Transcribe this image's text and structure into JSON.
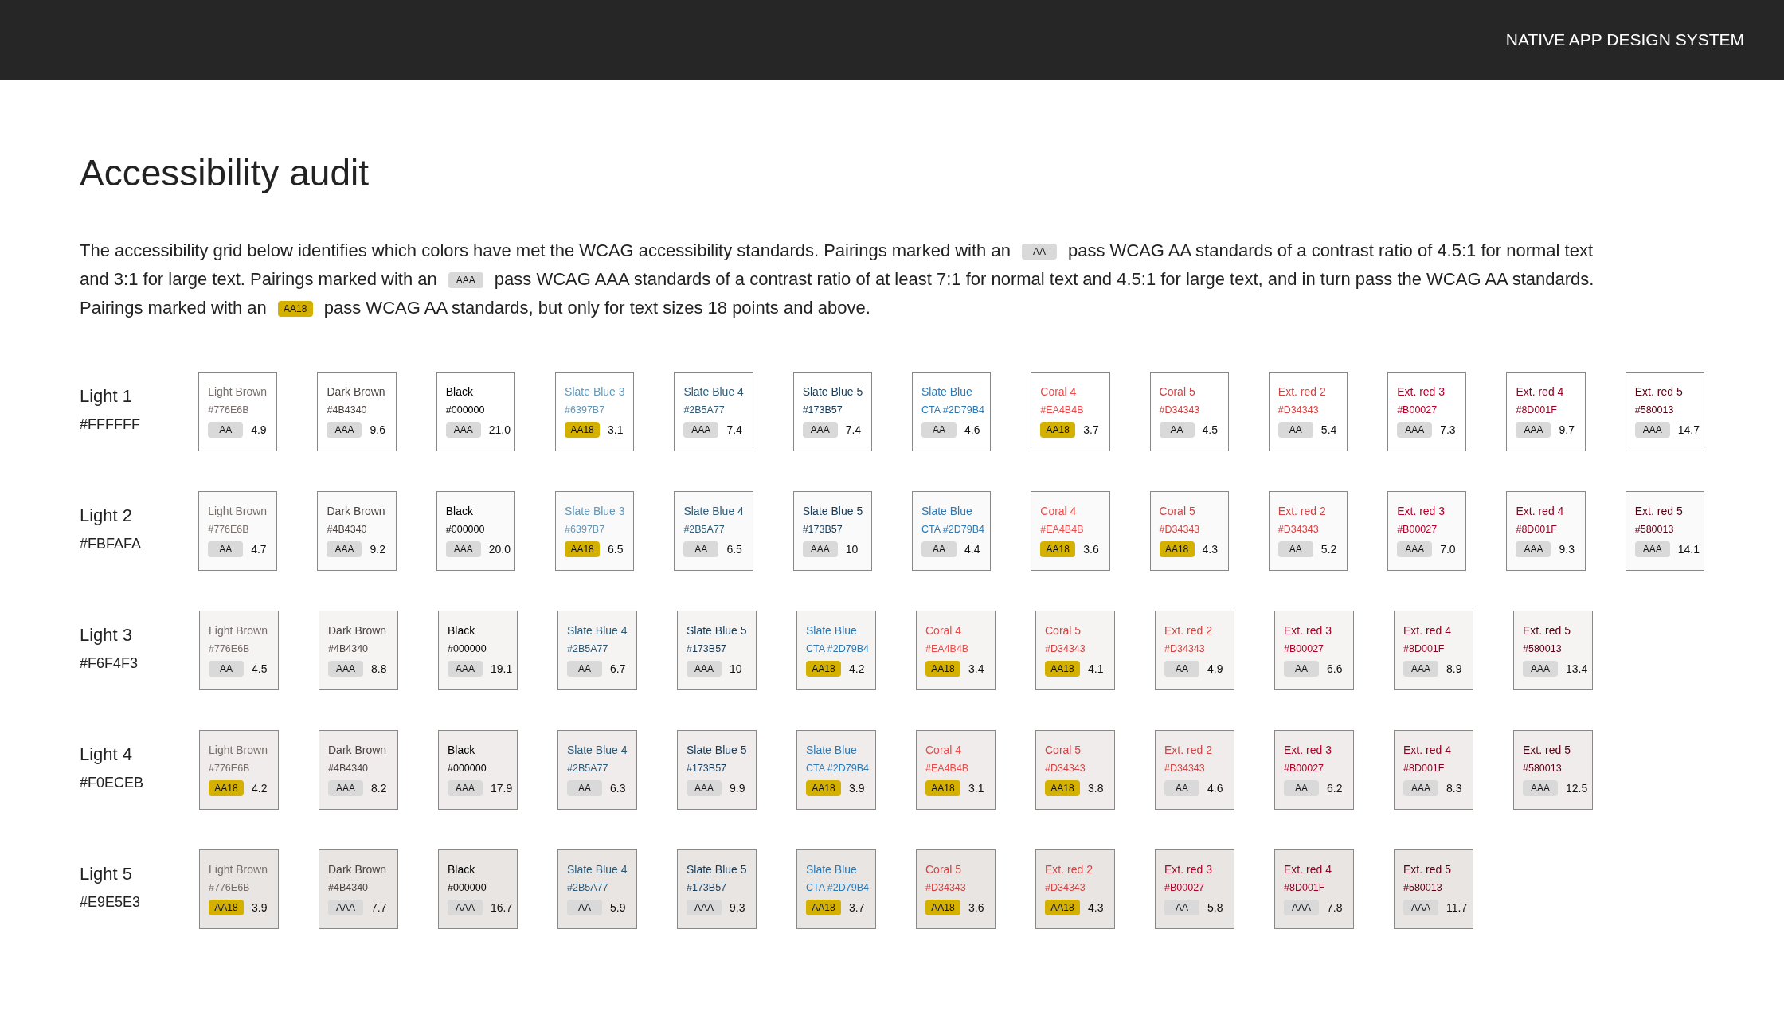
{
  "header": {
    "title": "NATIVE APP DESIGN SYSTEM"
  },
  "page_title": "Accessibility audit",
  "intro": [
    {
      "kind": "text",
      "text": "The accessibility grid below identifies which colors have met the WCAG accessibility standards. Pairings marked with an"
    },
    {
      "kind": "aa",
      "text": "AA"
    },
    {
      "kind": "text",
      "text": "pass WCAG AA standards of a contrast ratio of 4.5:1 for normal text"
    },
    {
      "kind": "break"
    },
    {
      "kind": "text",
      "text": "and 3:1 for large text. Pairings marked with an"
    },
    {
      "kind": "aaa",
      "text": "AAA"
    },
    {
      "kind": "text",
      "text": "pass  WCAG AAA standards of a contrast ratio of at least 7:1 for normal text and 4.5:1 for large text, and in turn pass the WCAG AA standards."
    },
    {
      "kind": "break"
    },
    {
      "kind": "text",
      "text": "Pairings marked with an"
    },
    {
      "kind": "aa18",
      "text": "AA18"
    },
    {
      "kind": "text",
      "text": "pass WCAG AA standards, but only for text sizes 18 points and above."
    }
  ],
  "rows": [
    {
      "name": "Light 1",
      "hex": "#FFFFFF",
      "color": "#ffffff",
      "swatches": [
        {
          "name": "Light Brown",
          "hex": "#776E6B",
          "color": "#776e6b",
          "kind": "aa",
          "grade": "AA",
          "ratio": "4.9"
        },
        {
          "name": "Dark Brown",
          "hex": "#4B4340",
          "color": "#4b4340",
          "kind": "aaa",
          "grade": "AAA",
          "ratio": "9.6"
        },
        {
          "name": "Black",
          "hex": "#000000",
          "color": "#000000",
          "kind": "aaa",
          "grade": "AAA",
          "ratio": "21.0"
        },
        {
          "name": "Slate Blue 3",
          "hex": "#6397B7",
          "color": "#6397b7",
          "kind": "aa18",
          "grade": "AA18",
          "ratio": "3.1"
        },
        {
          "name": "Slate Blue 4",
          "hex": "#2B5A77",
          "color": "#2b5a77",
          "kind": "aaa",
          "grade": "AAA",
          "ratio": "7.4"
        },
        {
          "name": "Slate Blue 5",
          "hex": "#173B57",
          "color": "#173b57",
          "kind": "aaa",
          "grade": "AAA",
          "ratio": "7.4"
        },
        {
          "name": "Slate Blue",
          "hex": "CTA #2D79B4",
          "color": "#2d79b4",
          "kind": "aa",
          "grade": "AA",
          "ratio": "4.6"
        },
        {
          "name": "Coral 4",
          "hex": "#EA4B4B",
          "color": "#ea4b4b",
          "kind": "aa18",
          "grade": "AA18",
          "ratio": "3.7"
        },
        {
          "name": "Coral 5",
          "hex": "#D34343",
          "color": "#d34343",
          "kind": "aa",
          "grade": "AA",
          "ratio": "4.5"
        },
        {
          "name": "Ext. red 2",
          "hex": "#D34343",
          "color": "#d34343",
          "kind": "aa",
          "grade": "AA",
          "ratio": "5.4"
        },
        {
          "name": "Ext. red 3",
          "hex": "#B00027",
          "color": "#b00027",
          "kind": "aaa",
          "grade": "AAA",
          "ratio": "7.3"
        },
        {
          "name": "Ext. red 4",
          "hex": "#8D001F",
          "color": "#8d001f",
          "kind": "aaa",
          "grade": "AAA",
          "ratio": "9.7"
        },
        {
          "name": "Ext. red 5",
          "hex": "#580013",
          "color": "#580013",
          "kind": "aaa",
          "grade": "AAA",
          "ratio": "14.7"
        }
      ]
    },
    {
      "name": "Light 2",
      "hex": "#FBFAFA",
      "color": "#fbfafa",
      "swatches": [
        {
          "name": "Light Brown",
          "hex": "#776E6B",
          "color": "#776e6b",
          "kind": "aa",
          "grade": "AA",
          "ratio": "4.7"
        },
        {
          "name": "Dark Brown",
          "hex": "#4B4340",
          "color": "#4b4340",
          "kind": "aaa",
          "grade": "AAA",
          "ratio": "9.2"
        },
        {
          "name": "Black",
          "hex": "#000000",
          "color": "#000000",
          "kind": "aaa",
          "grade": "AAA",
          "ratio": "20.0"
        },
        {
          "name": "Slate Blue 3",
          "hex": "#6397B7",
          "color": "#6397b7",
          "kind": "aa18",
          "grade": "AA18",
          "ratio": "6.5"
        },
        {
          "name": "Slate Blue 4",
          "hex": "#2B5A77",
          "color": "#2b5a77",
          "kind": "aa",
          "grade": "AA",
          "ratio": "6.5"
        },
        {
          "name": "Slate Blue 5",
          "hex": "#173B57",
          "color": "#173b57",
          "kind": "aaa",
          "grade": "AAA",
          "ratio": "10"
        },
        {
          "name": "Slate Blue",
          "hex": "CTA #2D79B4",
          "color": "#2d79b4",
          "kind": "aa",
          "grade": "AA",
          "ratio": "4.4"
        },
        {
          "name": "Coral 4",
          "hex": "#EA4B4B",
          "color": "#ea4b4b",
          "kind": "aa18",
          "grade": "AA18",
          "ratio": "3.6"
        },
        {
          "name": "Coral 5",
          "hex": "#D34343",
          "color": "#d34343",
          "kind": "aa18",
          "grade": "AA18",
          "ratio": "4.3"
        },
        {
          "name": "Ext. red 2",
          "hex": "#D34343",
          "color": "#d34343",
          "kind": "aa",
          "grade": "AA",
          "ratio": "5.2"
        },
        {
          "name": "Ext. red 3",
          "hex": "#B00027",
          "color": "#b00027",
          "kind": "aaa",
          "grade": "AAA",
          "ratio": "7.0"
        },
        {
          "name": "Ext. red 4",
          "hex": "#8D001F",
          "color": "#8d001f",
          "kind": "aaa",
          "grade": "AAA",
          "ratio": "9.3"
        },
        {
          "name": "Ext. red 5",
          "hex": "#580013",
          "color": "#580013",
          "kind": "aaa",
          "grade": "AAA",
          "ratio": "14.1"
        }
      ]
    },
    {
      "name": "Light 3",
      "hex": "#F6F4F3",
      "color": "#f6f4f3",
      "swatches": [
        {
          "name": "Light Brown",
          "hex": "#776E6B",
          "color": "#776e6b",
          "kind": "aa",
          "grade": "AA",
          "ratio": "4.5"
        },
        {
          "name": "Dark Brown",
          "hex": "#4B4340",
          "color": "#4b4340",
          "kind": "aaa",
          "grade": "AAA",
          "ratio": "8.8"
        },
        {
          "name": "Black",
          "hex": "#000000",
          "color": "#000000",
          "kind": "aaa",
          "grade": "AAA",
          "ratio": "19.1"
        },
        {
          "name": "Slate Blue 4",
          "hex": "#2B5A77",
          "color": "#2b5a77",
          "kind": "aa",
          "grade": "AA",
          "ratio": "6.7"
        },
        {
          "name": "Slate Blue 5",
          "hex": "#173B57",
          "color": "#173b57",
          "kind": "aaa",
          "grade": "AAA",
          "ratio": "10"
        },
        {
          "name": "Slate Blue",
          "hex": "CTA #2D79B4",
          "color": "#2d79b4",
          "kind": "aa18",
          "grade": "AA18",
          "ratio": "4.2"
        },
        {
          "name": "Coral 4",
          "hex": "#EA4B4B",
          "color": "#ea4b4b",
          "kind": "aa18",
          "grade": "AA18",
          "ratio": "3.4"
        },
        {
          "name": "Coral 5",
          "hex": "#D34343",
          "color": "#d34343",
          "kind": "aa18",
          "grade": "AA18",
          "ratio": "4.1"
        },
        {
          "name": "Ext. red 2",
          "hex": "#D34343",
          "color": "#d34343",
          "kind": "aa",
          "grade": "AA",
          "ratio": "4.9"
        },
        {
          "name": "Ext. red 3",
          "hex": "#B00027",
          "color": "#b00027",
          "kind": "aa",
          "grade": "AA",
          "ratio": "6.6"
        },
        {
          "name": "Ext. red 4",
          "hex": "#8D001F",
          "color": "#8d001f",
          "kind": "aaa",
          "grade": "AAA",
          "ratio": "8.9"
        },
        {
          "name": "Ext. red 5",
          "hex": "#580013",
          "color": "#580013",
          "kind": "aaa",
          "grade": "AAA",
          "ratio": "13.4"
        }
      ]
    },
    {
      "name": "Light 4",
      "hex": "#F0ECEB",
      "color": "#f0eceb",
      "swatches": [
        {
          "name": "Light Brown",
          "hex": "#776E6B",
          "color": "#776e6b",
          "kind": "aa18",
          "grade": "AA18",
          "ratio": "4.2"
        },
        {
          "name": "Dark Brown",
          "hex": "#4B4340",
          "color": "#4b4340",
          "kind": "aaa",
          "grade": "AAA",
          "ratio": "8.2"
        },
        {
          "name": "Black",
          "hex": "#000000",
          "color": "#000000",
          "kind": "aaa",
          "grade": "AAA",
          "ratio": "17.9"
        },
        {
          "name": "Slate Blue 4",
          "hex": "#2B5A77",
          "color": "#2b5a77",
          "kind": "aa",
          "grade": "AA",
          "ratio": "6.3"
        },
        {
          "name": "Slate Blue 5",
          "hex": "#173B57",
          "color": "#173b57",
          "kind": "aaa",
          "grade": "AAA",
          "ratio": "9.9"
        },
        {
          "name": "Slate Blue",
          "hex": "CTA #2D79B4",
          "color": "#2d79b4",
          "kind": "aa18",
          "grade": "AA18",
          "ratio": "3.9"
        },
        {
          "name": "Coral 4",
          "hex": "#EA4B4B",
          "color": "#ea4b4b",
          "kind": "aa18",
          "grade": "AA18",
          "ratio": "3.1"
        },
        {
          "name": "Coral 5",
          "hex": "#D34343",
          "color": "#d34343",
          "kind": "aa18",
          "grade": "AA18",
          "ratio": "3.8"
        },
        {
          "name": "Ext. red 2",
          "hex": "#D34343",
          "color": "#d34343",
          "kind": "aa",
          "grade": "AA",
          "ratio": "4.6"
        },
        {
          "name": "Ext. red 3",
          "hex": "#B00027",
          "color": "#b00027",
          "kind": "aa",
          "grade": "AA",
          "ratio": "6.2"
        },
        {
          "name": "Ext. red 4",
          "hex": "#8D001F",
          "color": "#8d001f",
          "kind": "aaa",
          "grade": "AAA",
          "ratio": "8.3"
        },
        {
          "name": "Ext. red 5",
          "hex": "#580013",
          "color": "#580013",
          "kind": "aaa",
          "grade": "AAA",
          "ratio": "12.5"
        }
      ]
    },
    {
      "name": "Light 5",
      "hex": "#E9E5E3",
      "color": "#e9e5e3",
      "swatches": [
        {
          "name": "Light Brown",
          "hex": "#776E6B",
          "color": "#776e6b",
          "kind": "aa18",
          "grade": "AA18",
          "ratio": "3.9"
        },
        {
          "name": "Dark Brown",
          "hex": "#4B4340",
          "color": "#4b4340",
          "kind": "aaa",
          "grade": "AAA",
          "ratio": "7.7"
        },
        {
          "name": "Black",
          "hex": "#000000",
          "color": "#000000",
          "kind": "aaa",
          "grade": "AAA",
          "ratio": "16.7"
        },
        {
          "name": "Slate Blue 4",
          "hex": "#2B5A77",
          "color": "#2b5a77",
          "kind": "aa",
          "grade": "AA",
          "ratio": "5.9"
        },
        {
          "name": "Slate Blue 5",
          "hex": "#173B57",
          "color": "#173b57",
          "kind": "aaa",
          "grade": "AAA",
          "ratio": "9.3"
        },
        {
          "name": "Slate Blue",
          "hex": "CTA #2D79B4",
          "color": "#2d79b4",
          "kind": "aa18",
          "grade": "AA18",
          "ratio": "3.7"
        },
        {
          "name": "Coral 5",
          "hex": "#D34343",
          "color": "#d34343",
          "kind": "aa18",
          "grade": "AA18",
          "ratio": "3.6"
        },
        {
          "name": "Ext. red 2",
          "hex": "#D34343",
          "color": "#d34343",
          "kind": "aa18",
          "grade": "AA18",
          "ratio": "4.3"
        },
        {
          "name": "Ext. red 3",
          "hex": "#B00027",
          "color": "#b00027",
          "kind": "aa",
          "grade": "AA",
          "ratio": "5.8"
        },
        {
          "name": "Ext. red 4",
          "hex": "#8D001F",
          "color": "#8d001f",
          "kind": "aaa",
          "grade": "AAA",
          "ratio": "7.8"
        },
        {
          "name": "Ext. red 5",
          "hex": "#580013",
          "color": "#580013",
          "kind": "aaa",
          "grade": "AAA",
          "ratio": "11.7"
        }
      ]
    }
  ]
}
